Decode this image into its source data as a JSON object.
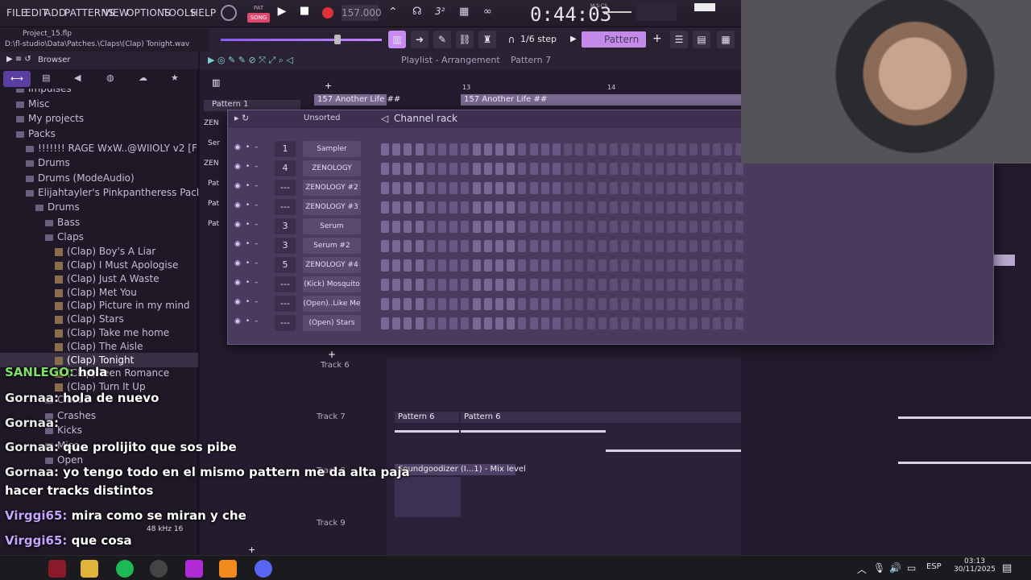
{
  "menu": [
    "FILE",
    "EDIT",
    "ADD",
    "PATTERNS",
    "VIEW",
    "OPTIONS",
    "TOOLS",
    "HELP"
  ],
  "transport": {
    "pat_label": "PAT",
    "song_label": "SONG",
    "tempo": "157.000",
    "time": "0:44:03",
    "time_unit": "M:S:CS"
  },
  "project": {
    "name": "Project_15.flp",
    "path": "D:\\fl-studio\\Data\\Patches.\\Claps\\(Clap) Tonight.wav"
  },
  "toolbar": {
    "step": "1/6 step",
    "pattern": "Pattern 7"
  },
  "browser": {
    "title": "Browser",
    "items": [
      {
        "label": "Impulses",
        "indent": 1,
        "kind": "folder"
      },
      {
        "label": "Misc",
        "indent": 1,
        "kind": "folder"
      },
      {
        "label": "My projects",
        "indent": 1,
        "kind": "folder"
      },
      {
        "label": "Packs",
        "indent": 1,
        "kind": "folder"
      },
      {
        "label": "!!!!!!! RAGE WxW..@WIIOLY v2 [FREE]",
        "indent": 2,
        "kind": "folder"
      },
      {
        "label": "Drums",
        "indent": 2,
        "kind": "folder"
      },
      {
        "label": "Drums (ModeAudio)",
        "indent": 2,
        "kind": "folder"
      },
      {
        "label": "Elijahtayler's Pinkpantheress Pack",
        "indent": 2,
        "kind": "folder"
      },
      {
        "label": "Drums",
        "indent": 3,
        "kind": "folder"
      },
      {
        "label": "Bass",
        "indent": 4,
        "kind": "folder"
      },
      {
        "label": "Claps",
        "indent": 4,
        "kind": "folder"
      },
      {
        "label": "(Clap) Boy's A Liar",
        "indent": 5,
        "kind": "wav"
      },
      {
        "label": "(Clap) I Must Apologise",
        "indent": 5,
        "kind": "wav"
      },
      {
        "label": "(Clap) Just A Waste",
        "indent": 5,
        "kind": "wav"
      },
      {
        "label": "(Clap) Met You",
        "indent": 5,
        "kind": "wav"
      },
      {
        "label": "(Clap) Picture in my mind",
        "indent": 5,
        "kind": "wav"
      },
      {
        "label": "(Clap) Stars",
        "indent": 5,
        "kind": "wav"
      },
      {
        "label": "(Clap) Take me home",
        "indent": 5,
        "kind": "wav"
      },
      {
        "label": "(Clap) The Aisle",
        "indent": 5,
        "kind": "wav"
      },
      {
        "label": "(Clap) Tonight",
        "indent": 5,
        "kind": "wav"
      },
      {
        "label": "(Clap) Teen Romance",
        "indent": 5,
        "kind": "wav"
      },
      {
        "label": "(Clap) Turn It Up",
        "indent": 5,
        "kind": "wav"
      },
      {
        "label": "Closed",
        "indent": 4,
        "kind": "folder"
      },
      {
        "label": "Crashes",
        "indent": 4,
        "kind": "folder"
      },
      {
        "label": "Kicks",
        "indent": 4,
        "kind": "folder"
      },
      {
        "label": "Misc",
        "indent": 4,
        "kind": "folder"
      },
      {
        "label": "Open",
        "indent": 4,
        "kind": "folder"
      }
    ],
    "samplerate": "48 kHz 16"
  },
  "playlist": {
    "title": "Playlist - Arrangement",
    "pattern": "Pattern 7",
    "bar13": "13",
    "bar14": "14",
    "clip_a": "157 Another Life ##",
    "clip_b": "157 Another Life ##",
    "pattern_list": [
      "Pattern 1",
      "ZEN",
      "Ser",
      "ZEN",
      "Pat",
      "Pat",
      "Pat"
    ],
    "tracks": [
      "Track 6",
      "Track 7",
      "Track 8",
      "Track 9"
    ],
    "track7_clips": [
      "Pattern 6",
      "Pattern 6"
    ],
    "automation": "Soundgoodizer (I...1) - Mix level"
  },
  "rack": {
    "title": "Channel rack",
    "filter": "Unsorted",
    "channels": [
      {
        "num": "1",
        "name": "Sampler"
      },
      {
        "num": "4",
        "name": "ZENOLOGY"
      },
      {
        "num": "---",
        "name": "ZENOLOGY #2"
      },
      {
        "num": "---",
        "name": "ZENOLOGY #3"
      },
      {
        "num": "3",
        "name": "Serum"
      },
      {
        "num": "3",
        "name": "Serum #2"
      },
      {
        "num": "5",
        "name": "ZENOLOGY #4"
      },
      {
        "num": "---",
        "name": "(Kick) Mosquito"
      },
      {
        "num": "---",
        "name": "(Open)..Like Me"
      },
      {
        "num": "---",
        "name": "(Open) Stars"
      }
    ],
    "add": "+"
  },
  "chat": [
    {
      "user": "SANLEGO:",
      "msg": "hola",
      "style": "g"
    },
    {
      "user": "Gornaa:",
      "msg": "hola de nuevo",
      "style": ""
    },
    {
      "user": "Gornaa:",
      "msg": "",
      "style": ""
    },
    {
      "user": "Gornaa:",
      "msg": "que prolijito que sos pibe",
      "style": ""
    },
    {
      "user": "Gornaa:",
      "msg": "yo tengo todo en el mismo pattern me da alta paja",
      "style": ""
    },
    {
      "user": "",
      "msg": "hacer tracks distintos",
      "style": ""
    },
    {
      "user": "Virggi65:",
      "msg": "mira como se miran   y   che",
      "style": "v"
    },
    {
      "user": "Virggi65:",
      "msg": "que cosa",
      "style": "v"
    },
    {
      "user": "Gornaa:",
      "msg": "",
      "style": ""
    }
  ],
  "taskbar": {
    "lang": "ESP",
    "time": "03:13",
    "date": "30/11/2025"
  }
}
